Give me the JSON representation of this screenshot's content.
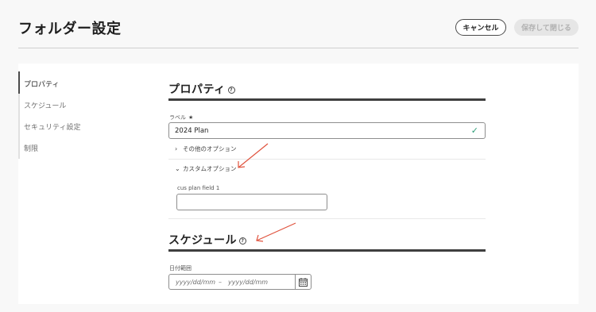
{
  "header": {
    "title": "フォルダー設定",
    "cancel_label": "キャンセル",
    "save_label": "保存して閉じる"
  },
  "sidenav": {
    "items": [
      {
        "label": "プロパティ",
        "active": true
      },
      {
        "label": "スケジュール",
        "active": false
      },
      {
        "label": "セキュリティ設定",
        "active": false
      },
      {
        "label": "制限",
        "active": false
      }
    ]
  },
  "properties": {
    "title": "プロパティ",
    "label_field": {
      "label": "ラベル",
      "required_mark": "★",
      "value": "2024 Plan"
    },
    "other_options": "その他のオプション",
    "custom_options": "カスタムオプション",
    "custom_field": {
      "label": "cus plan field 1",
      "value": ""
    }
  },
  "schedule": {
    "title": "スケジュール",
    "date_range": {
      "label": "日付範囲",
      "start_placeholder": "yyyy/dd/mm",
      "separator": "–",
      "end_placeholder": "yyyy/dd/mm"
    }
  },
  "icons": {
    "help": "help-circle-icon",
    "check": "checkmark-icon",
    "calendar": "calendar-icon",
    "annotation": "red-arrow-annotation"
  },
  "colors": {
    "check": "#2d9d78",
    "annotation_arrow": "#e0533e"
  }
}
